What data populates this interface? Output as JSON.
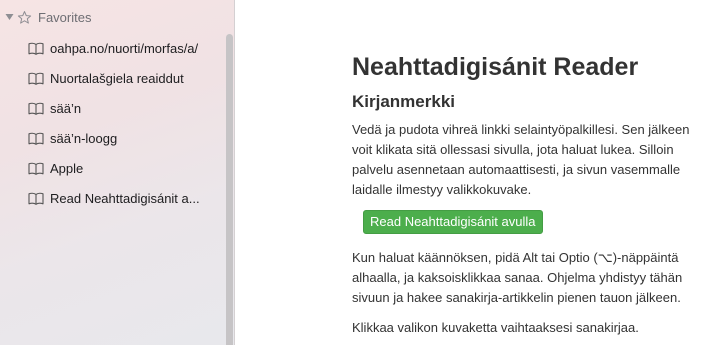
{
  "sidebar": {
    "favorites_label": "Favorites",
    "items": [
      {
        "label": "oahpa.no/nuorti/morfas/a/"
      },
      {
        "label": "Nuortalašgiela reaiddut"
      },
      {
        "label": "sää’n"
      },
      {
        "label": "sää’n-loogg"
      },
      {
        "label": "Apple"
      },
      {
        "label": "Read Neahttadigisánit a..."
      }
    ]
  },
  "main": {
    "title": "Neahttadigisánit Reader",
    "section_title": "Kirjanmerkki",
    "para1": "Vedä ja pudota vihreä linkki selaintyöpalkillesi. Sen jälkeen voit klikata sitä ollessasi sivulla, jota haluat lukea. Silloin palvelu asennetaan automaattisesti, ja sivun vasemmalle laidalle ilmestyy valikkokuvake.",
    "bookmarklet_label": "Read Neahttadigisánit avulla",
    "para2": "Kun haluat käännöksen, pidä Alt tai Optio (⌥)-näppäintä alhaalla, ja kaksoisklikkaa sanaa. Ohjelma yhdistyy tähän sivuun ja hakee sanakirja-artikkelin pienen tauon jälkeen.",
    "para3": "Klikkaa valikon kuvaketta vaihtaaksesi sanakirjaa."
  },
  "colors": {
    "button_green": "#4cae4c",
    "text": "#333333"
  }
}
